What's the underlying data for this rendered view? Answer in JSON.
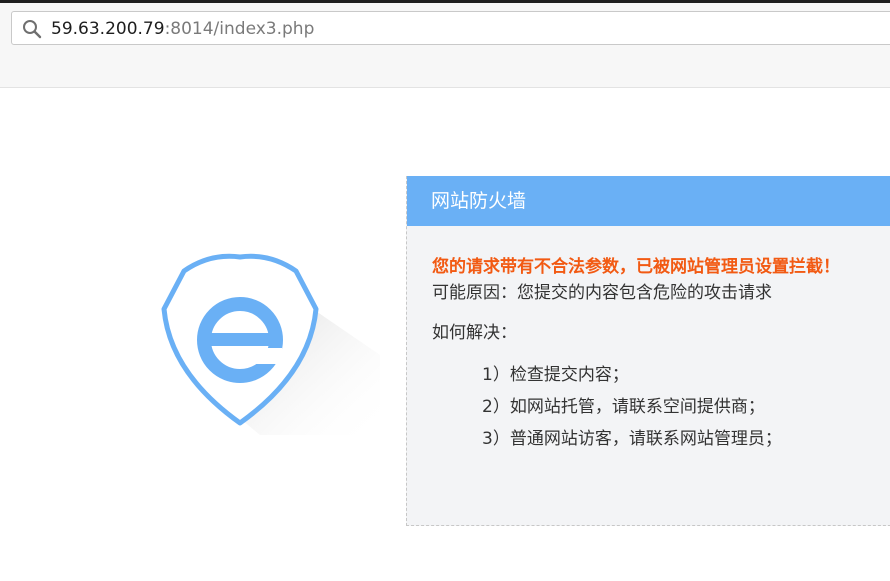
{
  "browser": {
    "url_host": "59.63.200.79",
    "url_rest": ":8014/index3.php",
    "search_icon": "search-icon"
  },
  "firewall": {
    "title": "网站防火墙",
    "warning": "您的请求带有不合法参数，已被网站管理员设置拦截！",
    "reason": "可能原因：您提交的内容包含危险的攻击请求",
    "howto": "如何解决：",
    "steps": [
      "1）检查提交内容；",
      "2）如网站托管，请联系空间提供商；",
      "3）普通网站访客，请联系网站管理员；"
    ],
    "logo_icon": "shield-e-icon"
  },
  "colors": {
    "header_blue": "#6ab0f5",
    "warning_orange": "#f25a13",
    "panel_bg": "#f3f4f6"
  }
}
